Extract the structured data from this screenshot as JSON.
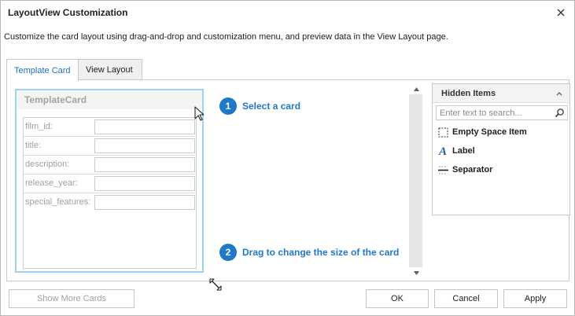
{
  "window": {
    "title": "LayoutView Customization",
    "description": "Customize the card layout using drag-and-drop and customization menu, and preview data in the View Layout page."
  },
  "tabs": [
    {
      "label": "Template Card",
      "active": true
    },
    {
      "label": "View Layout",
      "active": false
    }
  ],
  "template_card": {
    "caption": "TemplateCard",
    "fields": [
      {
        "label": "film_id:"
      },
      {
        "label": "title:"
      },
      {
        "label": "description:"
      },
      {
        "label": "release_year:"
      },
      {
        "label": "special_features:"
      }
    ]
  },
  "hints": [
    {
      "number": "1",
      "text": "Select a card"
    },
    {
      "number": "2",
      "text": "Drag to change the size of the card"
    }
  ],
  "hidden_items": {
    "title": "Hidden Items",
    "search_placeholder": "Enter text to search...",
    "items": [
      {
        "label": "Empty Space Item",
        "icon": "empty-space-icon"
      },
      {
        "label": "Label",
        "icon": "label-icon"
      },
      {
        "label": "Separator",
        "icon": "separator-icon"
      }
    ]
  },
  "buttons": {
    "show_more_cards": "Show More Cards",
    "ok": "OK",
    "cancel": "Cancel",
    "apply": "Apply"
  },
  "colors": {
    "accent": "#1f78c8",
    "card_border": "#9dd3ef"
  }
}
